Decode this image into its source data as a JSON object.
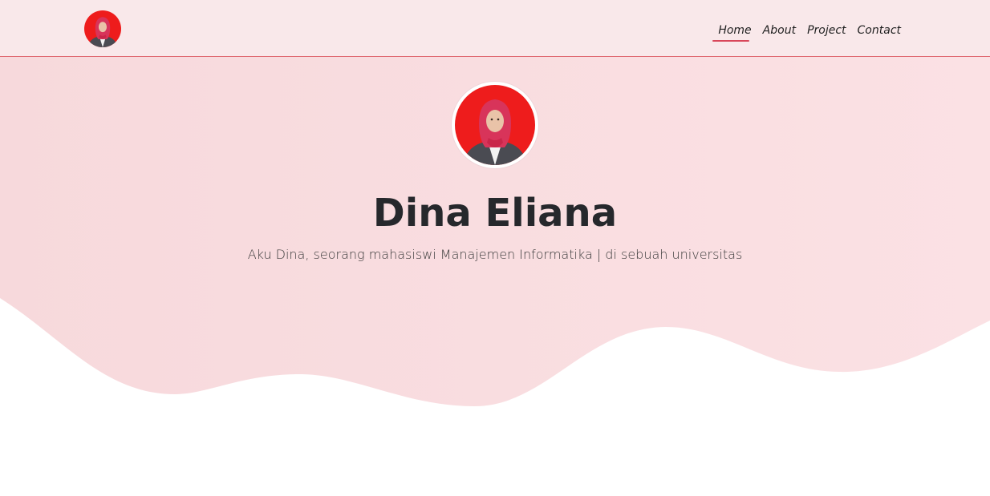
{
  "brand": {
    "logo_icon": "profile-photo-icon",
    "accent_color": "#d9475a",
    "hero_color": "#f8dadd",
    "nav_color": "#f9e8ea"
  },
  "nav": {
    "items": [
      {
        "label": "Home",
        "active": true
      },
      {
        "label": "About",
        "active": false
      },
      {
        "label": "Project",
        "active": false
      },
      {
        "label": "Contact",
        "active": false
      }
    ]
  },
  "hero": {
    "name": "Dina Eliana",
    "tagline": "Aku Dina, seorang mahasiswi Manajemen Informatika | di sebuah universitas",
    "avatar_icon": "profile-photo-icon"
  }
}
